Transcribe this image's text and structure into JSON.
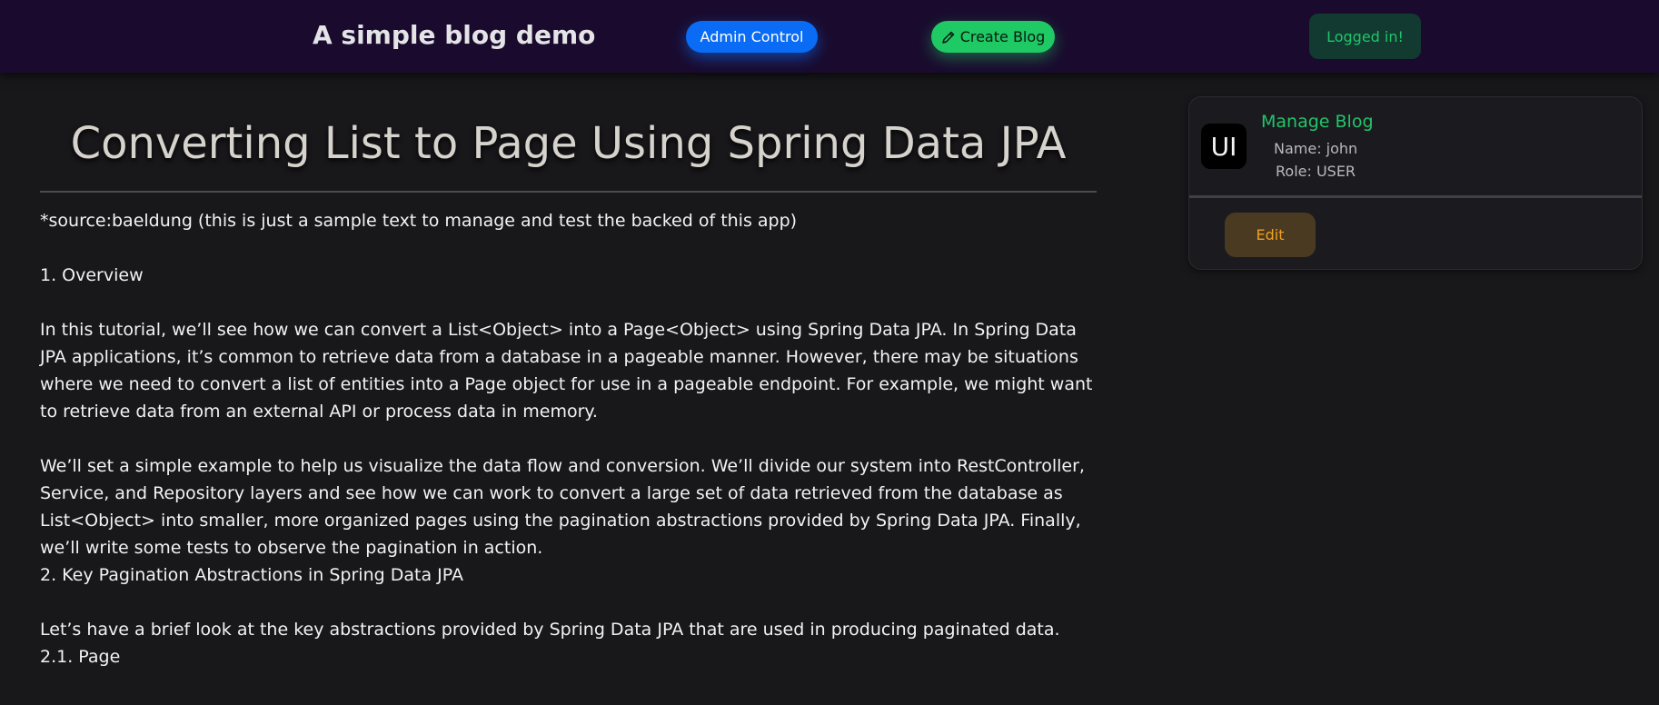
{
  "navbar": {
    "brand": "A simple blog demo",
    "admin_label": "Admin Control",
    "create_label": "Create Blog",
    "status_label": "Logged in!"
  },
  "post": {
    "title": "Converting List to Page Using Spring Data JPA",
    "paragraphs": [
      "*source:baeldung (this is just a sample text to manage and test the backed of this app)",
      "1. Overview",
      "In this tutorial, we’ll see how we can convert a List<Object> into a Page<Object> using Spring Data JPA. In Spring Data JPA applications, it’s common to retrieve data from a database in a pageable manner. However, there may be situations where we need to convert a list of entities into a Page object for use in a pageable endpoint. For example, we might want to retrieve data from an external API or process data in memory.",
      "We’ll set a simple example to help us visualize the data flow and conversion. We’ll divide our system into RestController, Service, and Repository layers and see how we can work to convert a large set of data retrieved from the database as List<Object> into smaller, more organized pages using the pagination abstractions provided by Spring Data JPA. Finally, we’ll write some tests to observe the pagination in action.\n2. Key Pagination Abstractions in Spring Data JPA",
      "Let’s have a brief look at the key abstractions provided by Spring Data JPA that are used in producing paginated data.\n2.1. Page"
    ]
  },
  "sidebar": {
    "avatar_text": "UI",
    "title": "Manage Blog",
    "name_line": "Name: john",
    "role_line": "Role: USER",
    "edit_label": "Edit"
  },
  "colors": {
    "background": "#18181b",
    "navbar": "#1a0b2e",
    "admin_button": "#0a6cf5",
    "create_button": "#1fc964",
    "accent_green": "#22c46a",
    "edit_text": "#f0a020"
  },
  "icons": {
    "create_button_icon": "pencil-icon"
  }
}
